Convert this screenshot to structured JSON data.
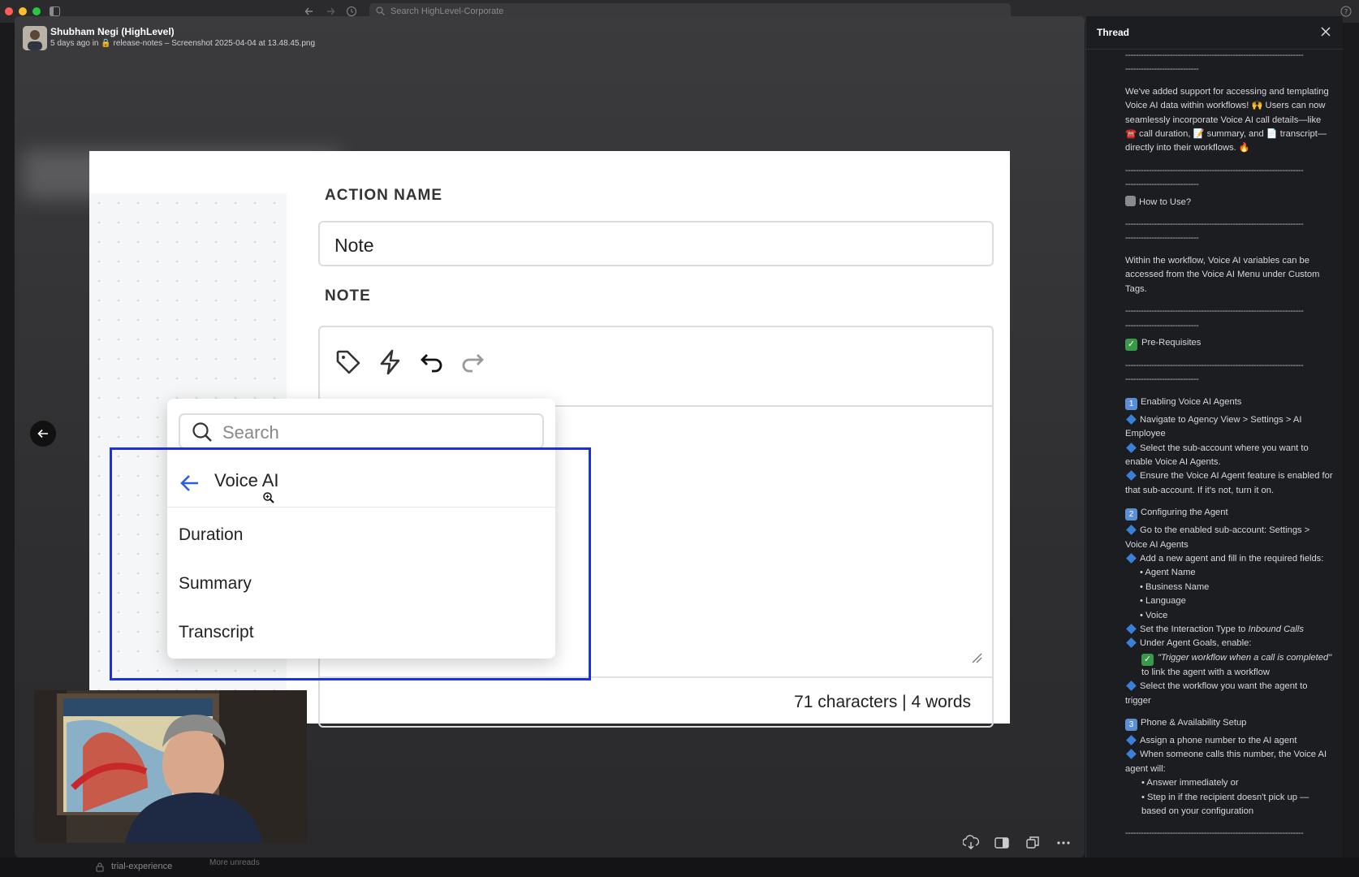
{
  "window": {
    "search_placeholder": "Search HighLevel-Corporate"
  },
  "header": {
    "author": "Shubham Negi (HighLevel)",
    "meta": "5 days ago in 🔒 release-notes – Screenshot 2025-04-04 at 13.48.45.png"
  },
  "screenshot": {
    "action_name_label": "ACTION NAME",
    "action_name_value": "Note",
    "note_label": "NOTE",
    "counter": "71 characters | 4 words",
    "dropdown": {
      "search_placeholder": "Search",
      "group_title": "Voice AI",
      "items": [
        "Duration",
        "Summary",
        "Transcript"
      ]
    }
  },
  "bottom_tabs": {
    "channel": "trial-experience",
    "more": "More unreads"
  },
  "thread": {
    "title": "Thread",
    "intro": "We've added support for accessing and templating Voice AI data within workflows! 🙌 Users can now seamlessly incorporate Voice AI call details—like ☎️ call duration, 📝 summary, and 📄 transcript—directly into their workflows. 🔥",
    "how_to_use": "How to Use?",
    "how_to_use_text": "Within the workflow, Voice AI variables can be accessed from the Voice AI Menu under Custom Tags.",
    "prereq": "Pre-Requisites",
    "sec1_title": "Enabling Voice AI Agents",
    "sec1_items": [
      "Navigate to Agency View > Settings > AI Employee",
      "Select the sub-account where you want to enable Voice AI Agents.",
      "Ensure the Voice AI Agent feature is enabled for that sub-account. If it's not, turn it on."
    ],
    "sec2_title": "Configuring the Agent",
    "sec2_item1": "Go to the enabled sub-account: Settings > Voice AI Agents",
    "sec2_item2": "Add a new agent and fill in the required fields:",
    "sec2_fields": [
      "Agent Name",
      "Business Name",
      "Language",
      "Voice"
    ],
    "sec2_item3_a": "Set the Interaction Type to ",
    "sec2_item3_b": "Inbound Calls",
    "sec2_item4": "Under Agent Goals, enable:",
    "sec2_item5_a": "\"Trigger workflow when a call is completed\"",
    "sec2_item5_b": " to link the agent with a workflow",
    "sec2_item6": "Select the workflow you want the agent to trigger",
    "sec3_title": "Phone & Availability Setup",
    "sec3_item1": "Assign a phone number to the AI agent",
    "sec3_item2": "When someone calls this number, the Voice AI agent will:",
    "sec3_sub": [
      "Answer immediately or",
      "Step in if the recipient doesn't pick up — based on your configuration"
    ],
    "dash_long": "--------------------------------------------------------------------",
    "dash_short": "----------------------------"
  }
}
